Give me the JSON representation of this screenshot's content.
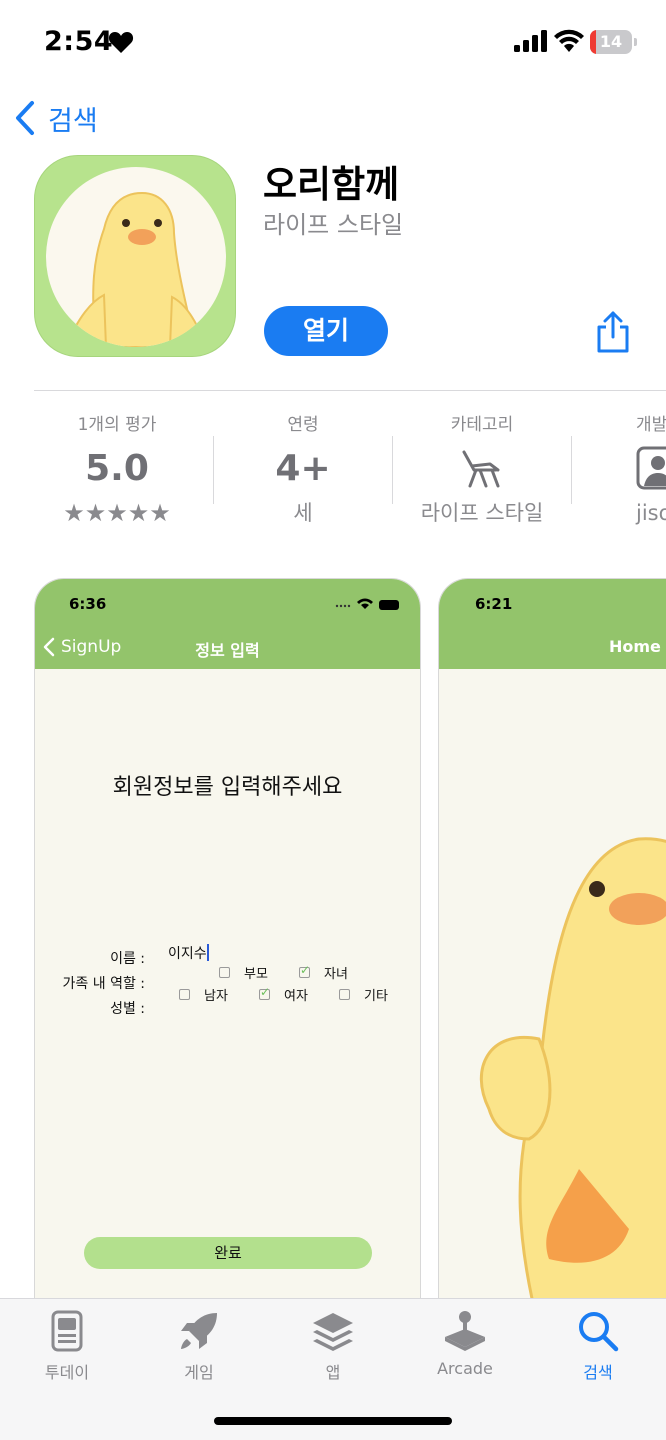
{
  "status_bar": {
    "time": "2:54",
    "battery": "14",
    "battery_level": 0.14
  },
  "nav": {
    "back_label": "검색"
  },
  "app": {
    "name": "오리함께",
    "category": "라이프 스타일",
    "open_label": "열기"
  },
  "info": {
    "ratings": {
      "label": "1개의 평가",
      "value": "5.0",
      "stars": "★★★★★",
      "star_count": 5
    },
    "age": {
      "label": "연령",
      "value": "4+",
      "sub": "세"
    },
    "category": {
      "label": "카테고리",
      "sub": "라이프 스타일"
    },
    "developer": {
      "label": "개발",
      "sub": "jisoo"
    }
  },
  "screenshot1": {
    "time": "6:36",
    "back_label": "SignUp",
    "title": "정보 입력",
    "heading": "회원정보를 입력해주세요",
    "name_label": "이름 :",
    "name_value": "이지수",
    "role_label": "가족 내 역할 :",
    "role_options": [
      {
        "label": "부모",
        "checked": false
      },
      {
        "label": "자녀",
        "checked": true
      }
    ],
    "gender_label": "성별 :",
    "gender_options": [
      {
        "label": "남자",
        "checked": false
      },
      {
        "label": "여자",
        "checked": true
      },
      {
        "label": "기타",
        "checked": false
      }
    ],
    "done_label": "완료"
  },
  "screenshot2": {
    "time": "6:21",
    "title": "Home"
  },
  "tabbar": {
    "tabs": [
      {
        "label": "투데이",
        "icon": "today-icon",
        "active": false
      },
      {
        "label": "게임",
        "icon": "rocket-icon",
        "active": false
      },
      {
        "label": "앱",
        "icon": "layers-icon",
        "active": false
      },
      {
        "label": "Arcade",
        "icon": "joystick-icon",
        "active": false
      },
      {
        "label": "검색",
        "icon": "search-icon",
        "active": true
      }
    ]
  },
  "colors": {
    "accent": "#1a7cf2",
    "app_green": "#b7e38d",
    "header_green": "#93c46b",
    "button_green": "#b3e08d"
  }
}
